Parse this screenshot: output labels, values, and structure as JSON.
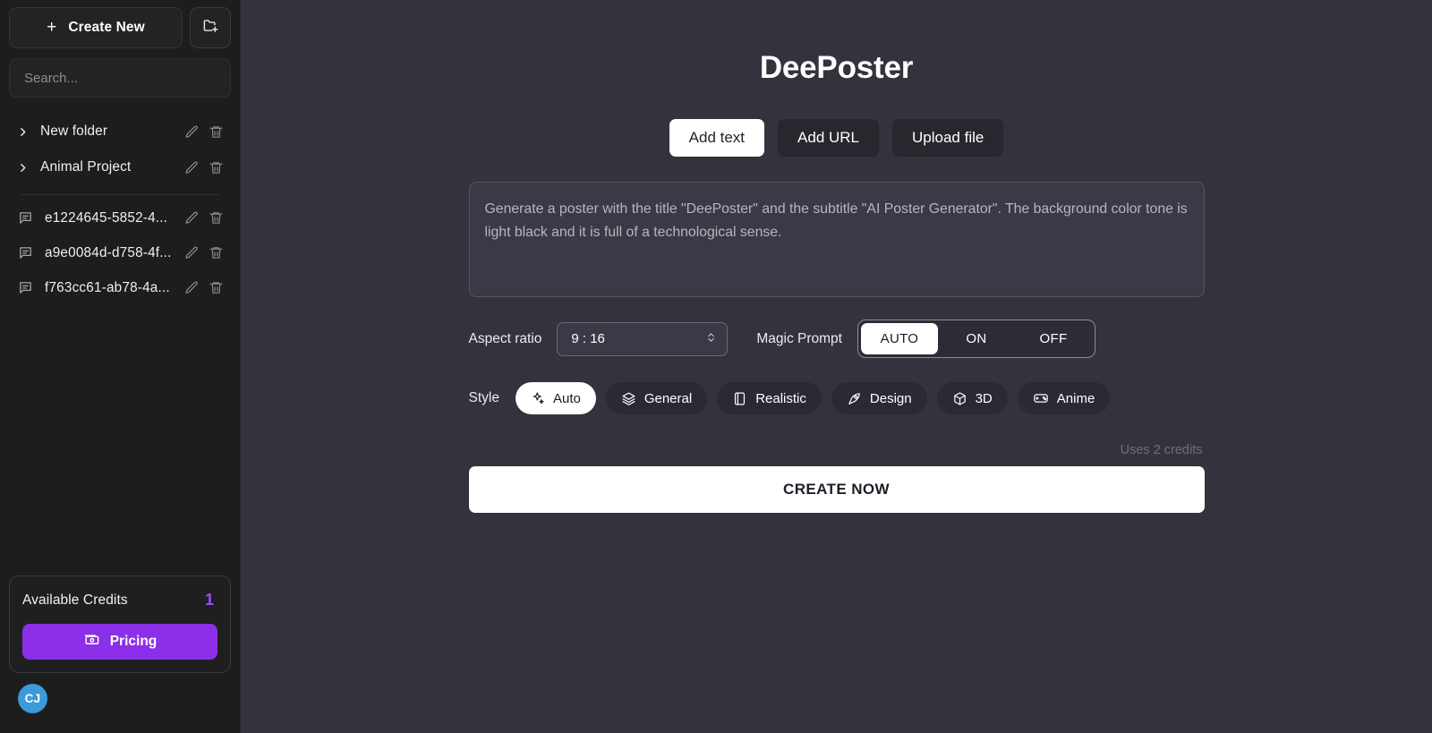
{
  "sidebar": {
    "create_new_label": "Create New",
    "new_folder_icon": "folder-plus-icon",
    "search": {
      "placeholder": "Search..."
    },
    "folders": [
      {
        "label": "New folder",
        "chevron": "chevron-right-icon"
      },
      {
        "label": "Animal Project",
        "chevron": "chevron-right-icon"
      }
    ],
    "chats": [
      {
        "label": "e1224645-5852-4...",
        "icon": "message-icon"
      },
      {
        "label": "a9e0084d-d758-4f...",
        "icon": "message-icon"
      },
      {
        "label": "f763cc61-ab78-4a...",
        "icon": "message-icon"
      }
    ],
    "row_actions": {
      "edit": "pencil-icon",
      "delete": "trash-icon"
    },
    "credits": {
      "label": "Available Credits",
      "value": "1",
      "value_color": "#9b4dff",
      "pricing_label": "Pricing",
      "pricing_icon": "banknote-icon",
      "pricing_color": "#8b2fe8"
    },
    "avatar": {
      "initials": "CJ",
      "color": "#3b9ad9"
    }
  },
  "main": {
    "title": "DeePoster",
    "source_tabs": [
      {
        "label": "Add text",
        "active": true
      },
      {
        "label": "Add URL",
        "active": false
      },
      {
        "label": "Upload file",
        "active": false
      }
    ],
    "prompt": {
      "value": "Generate a poster with the title \"DeePoster\" and the subtitle \"AI Poster Generator\". The background color tone is light black and it is full of a technological sense.",
      "placeholder": "Generate a poster with the title \"DeePoster\" and the subtitle \"AI Poster Generator\". The background color tone is light black and it is full of a technological sense."
    },
    "aspect_ratio": {
      "label": "Aspect ratio",
      "value": "9 : 16",
      "stepper_icon": "chevron-updown-icon"
    },
    "magic_prompt": {
      "label": "Magic Prompt",
      "options": [
        {
          "label": "AUTO",
          "active": true
        },
        {
          "label": "ON",
          "active": false
        },
        {
          "label": "OFF",
          "active": false
        }
      ]
    },
    "style": {
      "label": "Style",
      "options": [
        {
          "label": "Auto",
          "icon": "sparkles-icon",
          "active": true
        },
        {
          "label": "General",
          "icon": "layers-icon",
          "active": false
        },
        {
          "label": "Realistic",
          "icon": "phone-frame-icon",
          "active": false
        },
        {
          "label": "Design",
          "icon": "pen-nib-icon",
          "active": false
        },
        {
          "label": "3D",
          "icon": "cube-icon",
          "active": false
        },
        {
          "label": "Anime",
          "icon": "gamepad-icon",
          "active": false
        }
      ]
    },
    "credits_note": "Uses 2 credits",
    "create_button": "CREATE NOW"
  }
}
